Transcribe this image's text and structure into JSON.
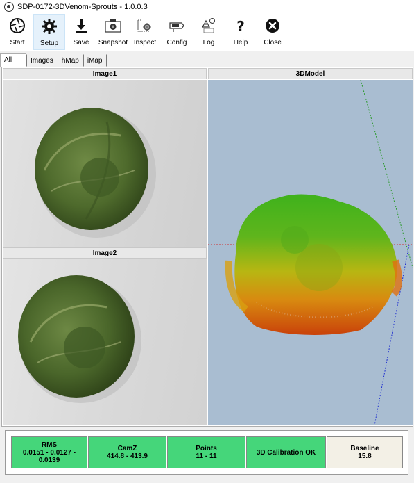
{
  "window": {
    "title": "SDP-0172-3DVenom-Sprouts - 1.0.0.3"
  },
  "toolbar": {
    "buttons": [
      {
        "label": "Start",
        "icon": "shutter-icon"
      },
      {
        "label": "Setup",
        "icon": "gear-icon"
      },
      {
        "label": "Save",
        "icon": "download-icon"
      },
      {
        "label": "Snapshot",
        "icon": "camera-icon"
      },
      {
        "label": "Inspect",
        "icon": "inspect-icon"
      },
      {
        "label": "Config",
        "icon": "config-icon"
      },
      {
        "label": "Log",
        "icon": "log-icon"
      },
      {
        "label": "Help",
        "icon": "question-icon"
      },
      {
        "label": "Close",
        "icon": "close-icon"
      }
    ]
  },
  "tabs": [
    {
      "label": "All",
      "selected": true
    },
    {
      "label": "Images",
      "selected": false
    },
    {
      "label": "hMap",
      "selected": false
    },
    {
      "label": "iMap",
      "selected": false
    }
  ],
  "panes": {
    "image1_title": "Image1",
    "image2_title": "Image2",
    "model_title": "3DModel"
  },
  "status": {
    "rms_label": "RMS",
    "rms_value_line1": "0.0151 - 0.0127 -",
    "rms_value_line2": "0.0139",
    "camz_label": "CamZ",
    "camz_value": "414.8 - 413.9",
    "points_label": "Points",
    "points_value": "11 - 11",
    "calibration": "3D Calibration OK",
    "baseline_label": "Baseline",
    "baseline_value": "15.8"
  },
  "colors": {
    "ok_green": "#45d67a",
    "neutral": "#f3f0e6",
    "model_bg": "#a9bdd1"
  }
}
